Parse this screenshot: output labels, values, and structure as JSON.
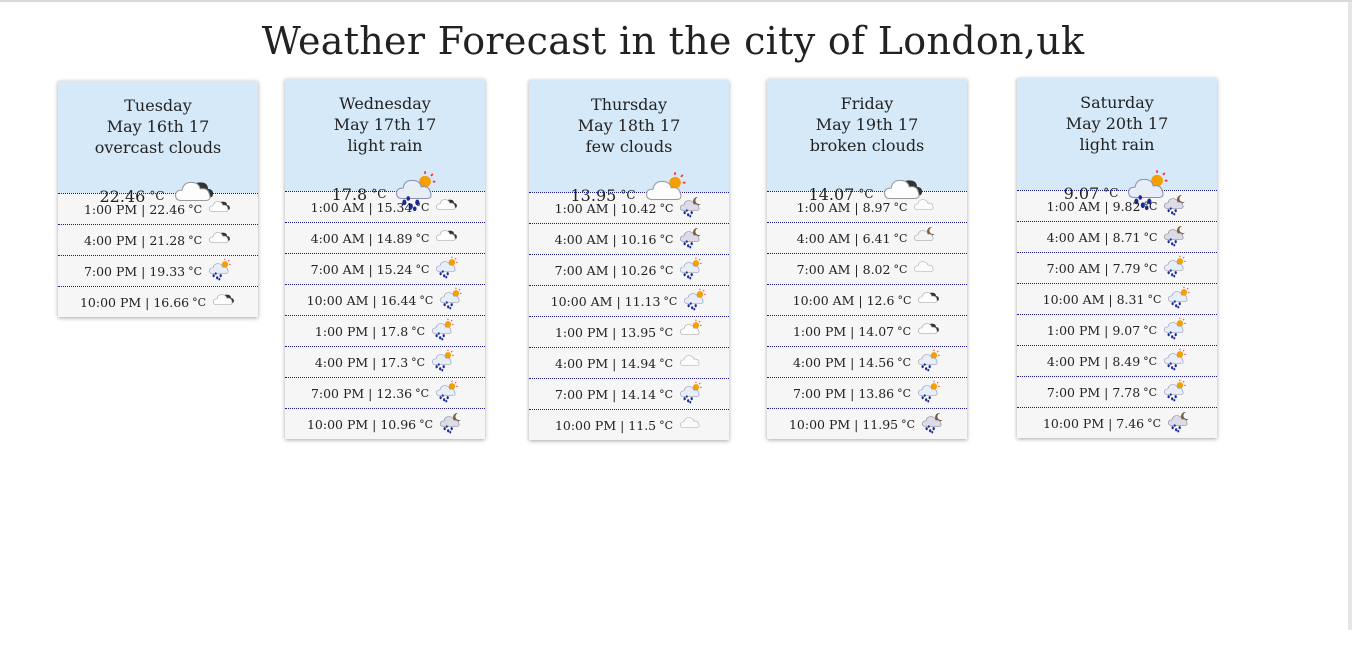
{
  "page": {
    "title": "Weather Forecast in the city of London,uk"
  },
  "days": [
    {
      "day": "Tuesday",
      "date": "May 16th 17",
      "desc": "overcast clouds",
      "temp": "22.46",
      "unit": "°C",
      "icon": "overcast-clouds",
      "hours": [
        {
          "text": "1:00 PM | 22.46",
          "icon": "overcast-clouds"
        },
        {
          "text": "4:00 PM | 21.28",
          "icon": "overcast-clouds"
        },
        {
          "text": "7:00 PM | 19.33",
          "icon": "light-rain"
        },
        {
          "text": "10:00 PM | 16.66",
          "icon": "overcast-clouds"
        }
      ]
    },
    {
      "day": "Wednesday",
      "date": "May 17th 17",
      "desc": "light rain",
      "temp": "17.8",
      "unit": "°C",
      "icon": "light-rain",
      "hours": [
        {
          "text": "1:00 AM | 15.34",
          "icon": "overcast-clouds"
        },
        {
          "text": "4:00 AM | 14.89",
          "icon": "overcast-clouds"
        },
        {
          "text": "7:00 AM | 15.24",
          "icon": "light-rain"
        },
        {
          "text": "10:00 AM | 16.44",
          "icon": "light-rain"
        },
        {
          "text": "1:00 PM | 17.8",
          "icon": "light-rain"
        },
        {
          "text": "4:00 PM | 17.3",
          "icon": "light-rain"
        },
        {
          "text": "7:00 PM | 12.36",
          "icon": "light-rain"
        },
        {
          "text": "10:00 PM | 10.96",
          "icon": "night-rain"
        }
      ]
    },
    {
      "day": "Thursday",
      "date": "May 18th 17",
      "desc": "few clouds",
      "temp": "13.95",
      "unit": "°C",
      "icon": "few-clouds",
      "hours": [
        {
          "text": "1:00 AM | 10.42",
          "icon": "night-rain"
        },
        {
          "text": "4:00 AM | 10.16",
          "icon": "night-rain"
        },
        {
          "text": "7:00 AM | 10.26",
          "icon": "light-rain"
        },
        {
          "text": "10:00 AM | 11.13",
          "icon": "light-rain"
        },
        {
          "text": "1:00 PM | 13.95",
          "icon": "few-clouds"
        },
        {
          "text": "4:00 PM | 14.94",
          "icon": "cloud"
        },
        {
          "text": "7:00 PM | 14.14",
          "icon": "light-rain"
        },
        {
          "text": "10:00 PM | 11.5",
          "icon": "cloud"
        }
      ]
    },
    {
      "day": "Friday",
      "date": "May 19th 17",
      "desc": "broken clouds",
      "temp": "14.07",
      "unit": "°C",
      "icon": "overcast-clouds",
      "hours": [
        {
          "text": "1:00 AM | 8.97",
          "icon": "cloud"
        },
        {
          "text": "4:00 AM | 6.41",
          "icon": "night-cloud"
        },
        {
          "text": "7:00 AM | 8.02",
          "icon": "cloud"
        },
        {
          "text": "10:00 AM | 12.6",
          "icon": "overcast-clouds"
        },
        {
          "text": "1:00 PM | 14.07",
          "icon": "overcast-clouds"
        },
        {
          "text": "4:00 PM | 14.56",
          "icon": "light-rain"
        },
        {
          "text": "7:00 PM | 13.86",
          "icon": "light-rain"
        },
        {
          "text": "10:00 PM | 11.95",
          "icon": "night-rain"
        }
      ]
    },
    {
      "day": "Saturday",
      "date": "May 20th 17",
      "desc": "light rain",
      "temp": "9.07",
      "unit": "°C",
      "icon": "light-rain",
      "hours": [
        {
          "text": "1:00 AM | 9.82",
          "icon": "night-rain"
        },
        {
          "text": "4:00 AM | 8.71",
          "icon": "night-rain"
        },
        {
          "text": "7:00 AM | 7.79",
          "icon": "light-rain"
        },
        {
          "text": "10:00 AM | 8.31",
          "icon": "light-rain"
        },
        {
          "text": "1:00 PM | 9.07",
          "icon": "light-rain"
        },
        {
          "text": "4:00 PM | 8.49",
          "icon": "light-rain"
        },
        {
          "text": "7:00 PM | 7.78",
          "icon": "light-rain"
        },
        {
          "text": "10:00 PM | 7.46",
          "icon": "night-rain"
        }
      ]
    }
  ],
  "colors": {
    "header_bg": "#d6e9f8",
    "row_bg": "#f6f6f6",
    "row_border": "#1a1a8c"
  }
}
